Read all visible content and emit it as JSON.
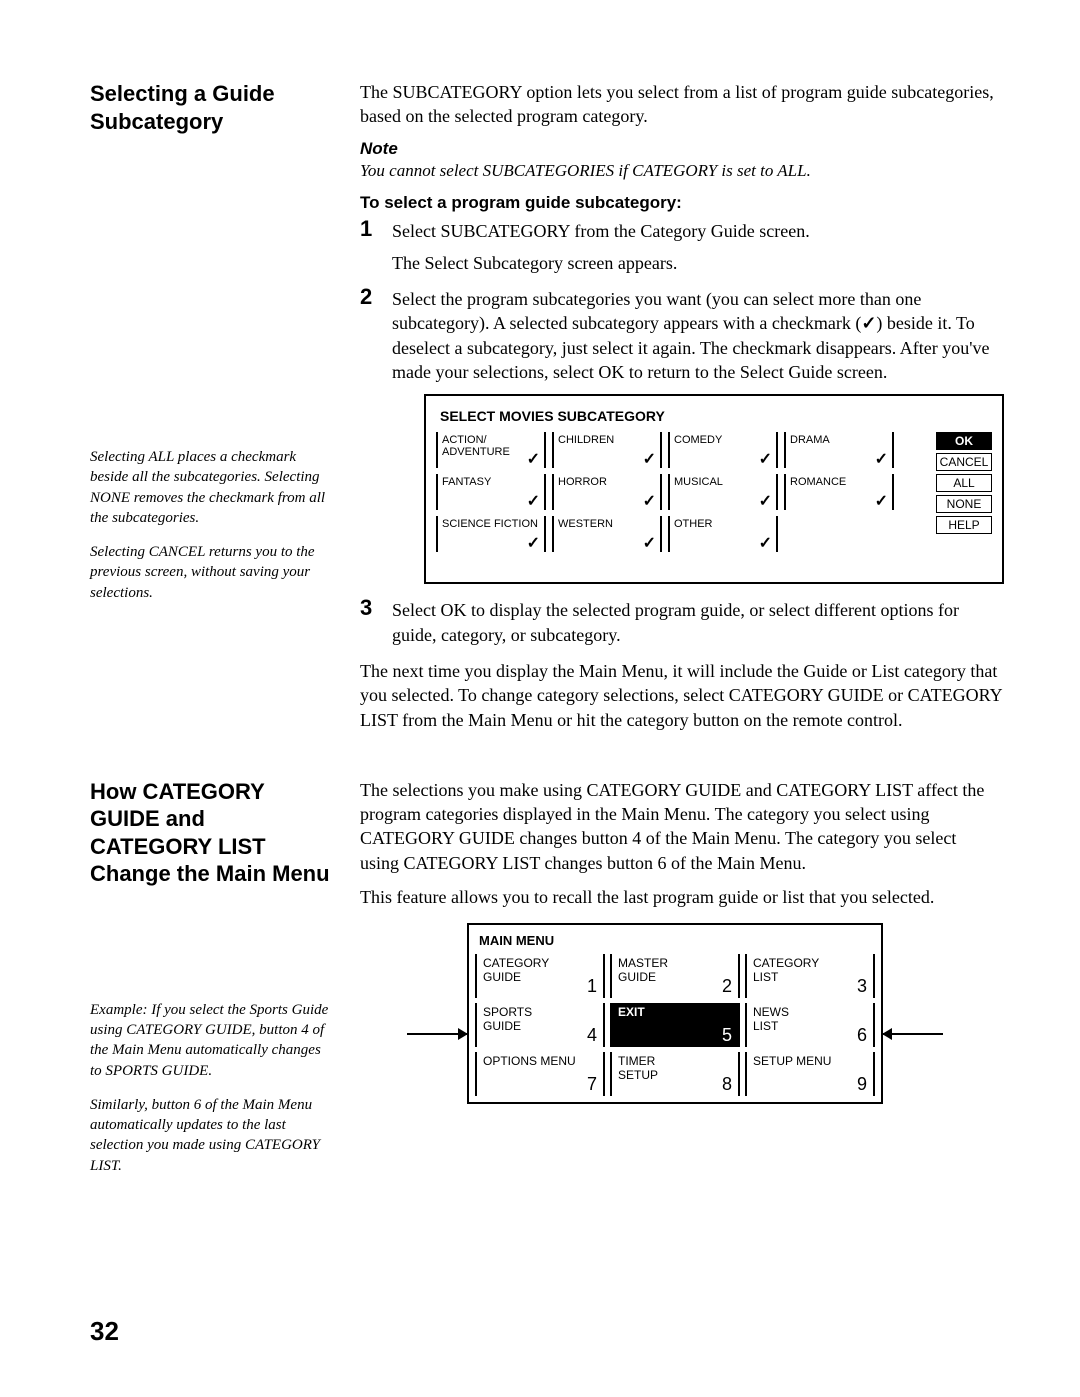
{
  "section1": {
    "heading": "Selecting a Guide Subcategory",
    "intro": "The SUBCATEGORY option lets you select from a list of program guide subcategories, based on the selected program category.",
    "note_label": "Note",
    "note_text": "You cannot select SUBCATEGORIES if CATEGORY is set to ALL.",
    "subhead": "To select a program guide subcategory:",
    "step1_a": "Select SUBCATEGORY from the Category Guide screen.",
    "step1_b": "The Select Subcategory screen appears.",
    "step2_a": "Select the program subcategories you want (you can select more than one subcategory). A selected subcategory appears with a checkmark (",
    "step2_chk": "✓",
    "step2_b": ") beside it. To deselect a subcategory, just select it again. The checkmark disappears. After you've made your selections, select OK to return to the Select Guide screen.",
    "step3": "Select OK to display the selected program guide, or select different options for guide, category, or subcategory.",
    "after_steps": "The next time you display the Main Menu, it will include the Guide or List category that you selected. To change category selections, select CATEGORY GUIDE or CATEGORY LIST from the Main Menu or hit the category button on the remote control.",
    "sidenote1": "Selecting ALL places a checkmark beside all the subcategories. Selecting NONE removes the checkmark from all the subcategories.",
    "sidenote2": "Selecting CANCEL returns you to the previous screen, without saving your selections."
  },
  "subcat_ui": {
    "title": "SELECT MOVIES SUBCATEGORY",
    "cells": [
      {
        "label": "ACTION/\nADVENTURE",
        "chk": true
      },
      {
        "label": "CHILDREN",
        "chk": true
      },
      {
        "label": "COMEDY",
        "chk": true
      },
      {
        "label": "DRAMA",
        "chk": true
      },
      {
        "label": "FANTASY",
        "chk": true
      },
      {
        "label": "HORROR",
        "chk": true
      },
      {
        "label": "MUSICAL",
        "chk": true
      },
      {
        "label": "ROMANCE",
        "chk": true
      },
      {
        "label": "SCIENCE FICTION",
        "chk": true
      },
      {
        "label": "WESTERN",
        "chk": true
      },
      {
        "label": "OTHER",
        "chk": true
      }
    ],
    "buttons": {
      "ok": "OK",
      "cancel": "CANCEL",
      "all": "ALL",
      "none": "NONE",
      "help": "HELP"
    }
  },
  "section2": {
    "heading": "How CATEGORY GUIDE and CATEGORY LIST Change the Main Menu",
    "p1": "The selections you make using CATEGORY GUIDE and CATEGORY LIST affect the program categories displayed in the Main Menu. The category you select using CATEGORY GUIDE changes button 4 of the Main Menu. The category you select using CATEGORY LIST changes button 6 of the Main Menu.",
    "p2": "This feature allows you to recall the last program guide or list that you selected.",
    "sidenote1": "Example: If you select the Sports Guide using CATEGORY GUIDE, button 4 of the Main Menu automatically changes to SPORTS GUIDE.",
    "sidenote2": "Similarly, button 6 of the Main Menu automatically updates to the last selection you made using CATEGORY LIST."
  },
  "main_menu": {
    "title": "MAIN MENU",
    "cells": [
      {
        "label": "CATEGORY\nGUIDE",
        "num": "1"
      },
      {
        "label": "MASTER\nGUIDE",
        "num": "2"
      },
      {
        "label": "CATEGORY\nLIST",
        "num": "3"
      },
      {
        "label": "SPORTS\nGUIDE",
        "num": "4"
      },
      {
        "label": "EXIT",
        "num": "5",
        "sel": true
      },
      {
        "label": "NEWS\nLIST",
        "num": "6"
      },
      {
        "label": "OPTIONS MENU",
        "num": "7"
      },
      {
        "label": "TIMER\nSETUP",
        "num": "8"
      },
      {
        "label": "SETUP MENU",
        "num": "9"
      }
    ]
  },
  "page_number": "32"
}
